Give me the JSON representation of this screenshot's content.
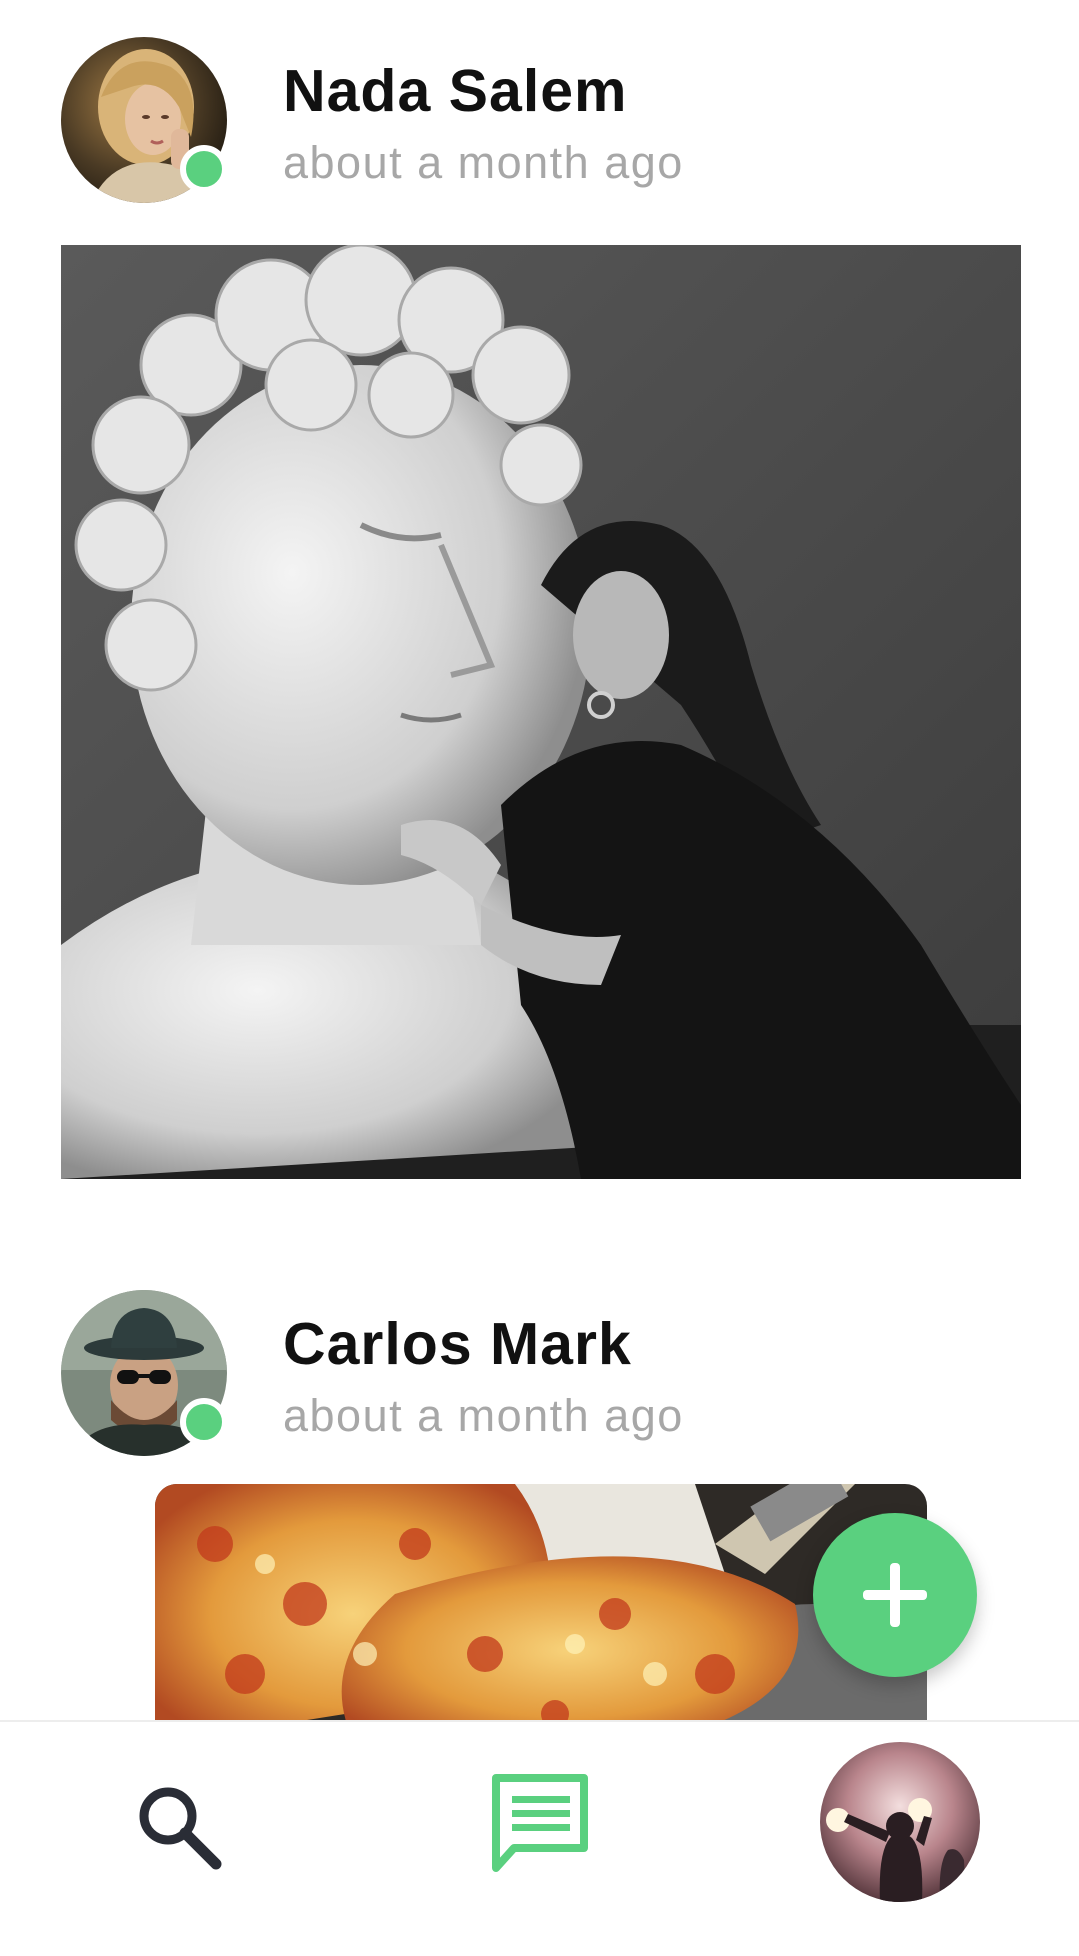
{
  "posts": [
    {
      "author": "Nada Salem",
      "time": "about a month ago",
      "online": true,
      "avatar_icon": "user-photo-blonde-woman",
      "image_icon": "photo-statue-and-woman"
    },
    {
      "author": "Carlos Mark",
      "time": "about a month ago",
      "online": true,
      "avatar_icon": "user-photo-man-hat",
      "image_icon": "photo-pizza"
    }
  ],
  "fab": {
    "icon": "plus-icon"
  },
  "nav": {
    "search_icon": "search-icon",
    "chat_icon": "chat-icon",
    "profile_icon": "profile-avatar"
  },
  "colors": {
    "accent": "#5ad07f",
    "name_text": "#111111",
    "time_text": "#a7a7a7",
    "icon_dark": "#2a2d36"
  }
}
